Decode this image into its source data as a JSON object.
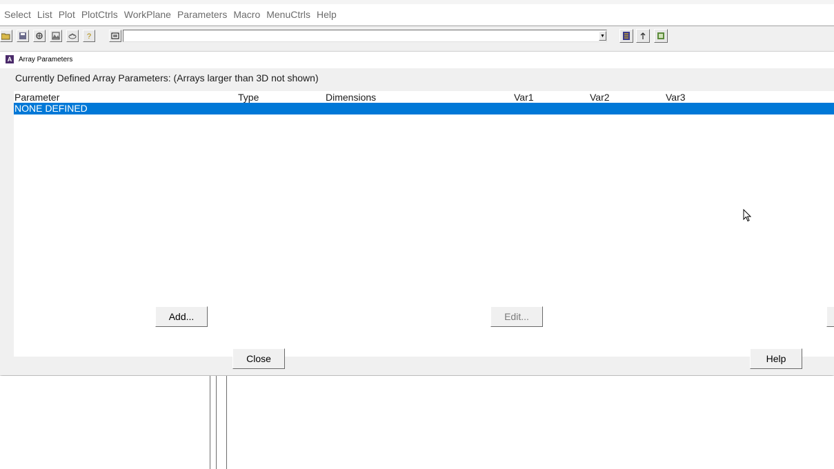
{
  "menubar": {
    "items": [
      {
        "label": "Select"
      },
      {
        "label": "List"
      },
      {
        "label": "Plot"
      },
      {
        "label": "PlotCtrls"
      },
      {
        "label": "WorkPlane"
      },
      {
        "label": "Parameters"
      },
      {
        "label": "Macro"
      },
      {
        "label": "MenuCtrls"
      },
      {
        "label": "Help"
      }
    ]
  },
  "toolbar": {
    "command_value": "",
    "icons": [
      "open-icon",
      "save-icon",
      "pan-zoom-icon",
      "image-capture-icon",
      "report-generator-icon",
      "help-icon",
      "keyboard-icon",
      "save-analysis-db-icon",
      "resume-db-icon",
      "toggle-icon"
    ]
  },
  "dialog": {
    "title": "Array Parameters",
    "app_icon_glyph": "A",
    "label": "Currently Defined Array Parameters: (Arrays larger than 3D not shown)",
    "columns": {
      "parameter": "Parameter",
      "type": "Type",
      "dimensions": "Dimensions",
      "var1": "Var1",
      "var2": "Var2",
      "var3": "Var3"
    },
    "rows": [
      {
        "parameter": "NONE DEFINED"
      }
    ],
    "buttons": {
      "add": "Add...",
      "edit": "Edit...",
      "close": "Close",
      "help": "Help"
    }
  },
  "colors": {
    "selection": "#0078d7",
    "dialog_bg": "#f0f0f0"
  }
}
